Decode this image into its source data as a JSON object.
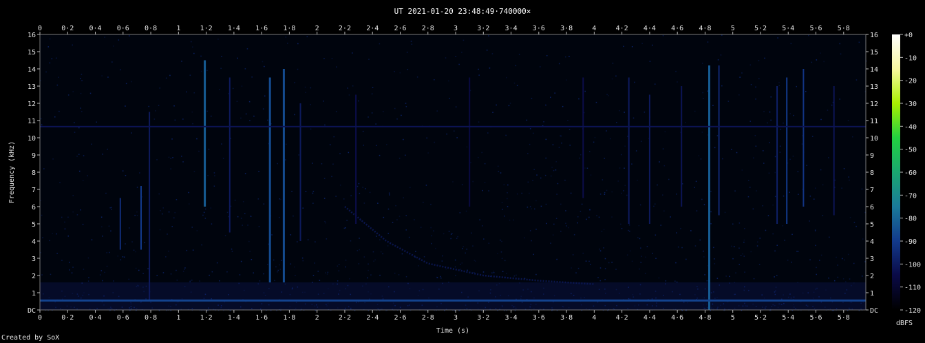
{
  "chart_data": {
    "type": "heatmap",
    "title": "UT 2021-01-20 23:48:49·740000×",
    "xlabel": "Time (s)",
    "ylabel": "Frequency (kHz)",
    "xlim": [
      0,
      5.96
    ],
    "ylim": [
      0,
      16
    ],
    "x_ticks": [
      "0",
      "0·2",
      "0·4",
      "0·6",
      "0·8",
      "1",
      "1·2",
      "1·4",
      "1·6",
      "1·8",
      "2",
      "2·2",
      "2·4",
      "2·6",
      "2·8",
      "3",
      "3·2",
      "3·4",
      "3·6",
      "3·8",
      "4",
      "4·2",
      "4·4",
      "4·6",
      "4·8",
      "5",
      "5·2",
      "5·4",
      "5·6",
      "5·8"
    ],
    "x_tick_values": [
      0,
      0.2,
      0.4,
      0.6,
      0.8,
      1.0,
      1.2,
      1.4,
      1.6,
      1.8,
      2.0,
      2.2,
      2.4,
      2.6,
      2.8,
      3.0,
      3.2,
      3.4,
      3.6,
      3.8,
      4.0,
      4.2,
      4.4,
      4.6,
      4.8,
      5.0,
      5.2,
      5.4,
      5.6,
      5.8
    ],
    "y_ticks": [
      "DC",
      "1",
      "2",
      "3",
      "4",
      "5",
      "6",
      "7",
      "8",
      "9",
      "10",
      "11",
      "12",
      "13",
      "14",
      "15",
      "16"
    ],
    "y_tick_values": [
      0,
      1,
      2,
      3,
      4,
      5,
      6,
      7,
      8,
      9,
      10,
      11,
      12,
      13,
      14,
      15,
      16
    ],
    "colorbar": {
      "label": "dBFS",
      "ticks": [
        "+0",
        "-10",
        "-20",
        "-30",
        "-40",
        "-50",
        "-60",
        "-70",
        "-80",
        "-90",
        "-100",
        "-110",
        "-120"
      ],
      "range": [
        -120,
        0
      ],
      "stops": [
        "#000000",
        "#0a0a46",
        "#123a8c",
        "#1a7a9a",
        "#1aa870",
        "#22d040",
        "#a8f000",
        "#f8f8a0",
        "#ffffff"
      ]
    },
    "features": {
      "hum_line_khz": [
        0.55,
        -88
      ],
      "tone_line_khz": [
        10.65,
        -102
      ],
      "low_band_khz": [
        0.35,
        -100
      ],
      "sweep": {
        "t": [
          2.2,
          2.5,
          2.8,
          3.2,
          3.6,
          4.0
        ],
        "f_khz": [
          6.0,
          4.0,
          2.7,
          2.0,
          1.7,
          1.5
        ],
        "level": -100
      },
      "vertical_bursts": [
        {
          "t": 0.58,
          "f_low": 3.5,
          "f_high": 6.5,
          "level": -94
        },
        {
          "t": 0.73,
          "f_low": 3.5,
          "f_high": 7.2,
          "level": -90
        },
        {
          "t": 0.79,
          "f_low": 0.5,
          "f_high": 11.5,
          "level": -100
        },
        {
          "t": 1.19,
          "f_low": 6.0,
          "f_high": 14.5,
          "level": -82
        },
        {
          "t": 1.37,
          "f_low": 4.5,
          "f_high": 13.5,
          "level": -100
        },
        {
          "t": 1.66,
          "f_low": 1.6,
          "f_high": 13.5,
          "level": -86
        },
        {
          "t": 1.76,
          "f_low": 1.6,
          "f_high": 14.0,
          "level": -86
        },
        {
          "t": 1.88,
          "f_low": 4.0,
          "f_high": 12.0,
          "level": -100
        },
        {
          "t": 2.28,
          "f_low": 5.0,
          "f_high": 12.5,
          "level": -104
        },
        {
          "t": 3.1,
          "f_low": 6.0,
          "f_high": 13.5,
          "level": -106
        },
        {
          "t": 3.92,
          "f_low": 6.5,
          "f_high": 13.5,
          "level": -104
        },
        {
          "t": 4.25,
          "f_low": 5.0,
          "f_high": 13.5,
          "level": -100
        },
        {
          "t": 4.4,
          "f_low": 5.0,
          "f_high": 12.5,
          "level": -100
        },
        {
          "t": 4.63,
          "f_low": 6.0,
          "f_high": 13.0,
          "level": -102
        },
        {
          "t": 4.83,
          "f_low": 0.0,
          "f_high": 14.2,
          "level": -82
        },
        {
          "t": 4.9,
          "f_low": 5.5,
          "f_high": 14.2,
          "level": -96
        },
        {
          "t": 5.32,
          "f_low": 5.0,
          "f_high": 13.0,
          "level": -98
        },
        {
          "t": 5.39,
          "f_low": 5.0,
          "f_high": 13.5,
          "level": -90
        },
        {
          "t": 5.51,
          "f_low": 6.0,
          "f_high": 14.0,
          "level": -92
        },
        {
          "t": 5.73,
          "f_low": 5.5,
          "f_high": 13.0,
          "level": -102
        }
      ]
    }
  },
  "footer": {
    "credit": "Created by SoX"
  }
}
